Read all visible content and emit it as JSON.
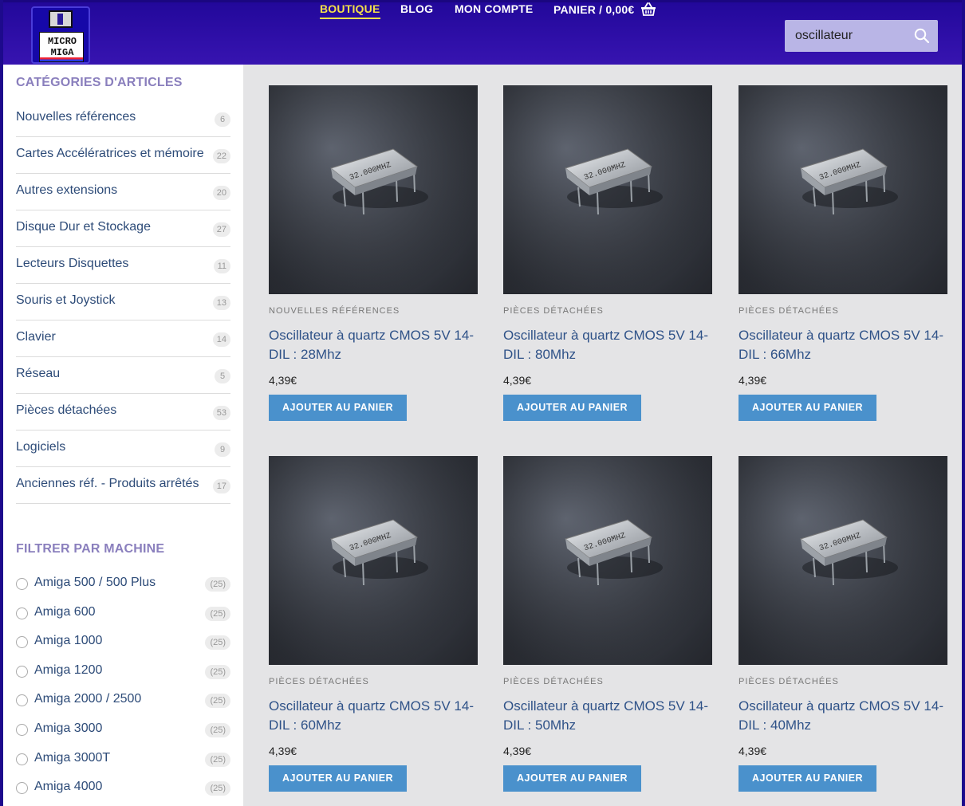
{
  "brand": {
    "logo_text": "MICRO MIGA"
  },
  "nav": {
    "items": [
      {
        "label": "BOUTIQUE",
        "active": true
      },
      {
        "label": "BLOG",
        "active": false
      },
      {
        "label": "MON COMPTE",
        "active": false
      },
      {
        "label": "PANIER / 0,00€",
        "active": false
      }
    ],
    "cart_icon": "basket-icon"
  },
  "search": {
    "value": "oscillateur",
    "icon": "search-icon"
  },
  "sidebar": {
    "categories_title": "CATÉGORIES D'ARTICLES",
    "categories": [
      {
        "label": "Nouvelles références",
        "count": "6"
      },
      {
        "label": "Cartes Accélératrices et mémoire",
        "count": "22"
      },
      {
        "label": "Autres extensions",
        "count": "20"
      },
      {
        "label": "Disque Dur et Stockage",
        "count": "27"
      },
      {
        "label": "Lecteurs Disquettes",
        "count": "11"
      },
      {
        "label": "Souris et Joystick",
        "count": "13"
      },
      {
        "label": "Clavier",
        "count": "14"
      },
      {
        "label": "Réseau",
        "count": "5"
      },
      {
        "label": "Pièces détachées",
        "count": "53"
      },
      {
        "label": "Logiciels",
        "count": "9"
      },
      {
        "label": "Anciennes réf. - Produits arrêtés",
        "count": "17"
      }
    ],
    "filter_title": "FILTRER PAR MACHINE",
    "filters": [
      {
        "label": "Amiga 500 / 500 Plus",
        "count": "(25)"
      },
      {
        "label": "Amiga 600",
        "count": "(25)"
      },
      {
        "label": "Amiga 1000",
        "count": "(25)"
      },
      {
        "label": "Amiga 1200",
        "count": "(25)"
      },
      {
        "label": "Amiga 2000 / 2500",
        "count": "(25)"
      },
      {
        "label": "Amiga 3000",
        "count": "(25)"
      },
      {
        "label": "Amiga 3000T",
        "count": "(25)"
      },
      {
        "label": "Amiga 4000",
        "count": "(25)"
      }
    ]
  },
  "products": [
    {
      "category": "NOUVELLES RÉFÉRENCES",
      "title": "Oscillateur à quartz CMOS 5V 14-DIL : 28Mhz",
      "price": "4,39€",
      "button": "AJOUTER AU PANIER",
      "chip_text": "32.000MHZ"
    },
    {
      "category": "PIÈCES DÉTACHÉES",
      "title": "Oscillateur à quartz CMOS 5V 14-DIL : 80Mhz",
      "price": "4,39€",
      "button": "AJOUTER AU PANIER",
      "chip_text": "32.000MHZ"
    },
    {
      "category": "PIÈCES DÉTACHÉES",
      "title": "Oscillateur à quartz CMOS 5V 14-DIL : 66Mhz",
      "price": "4,39€",
      "button": "AJOUTER AU PANIER",
      "chip_text": "32.000MHZ"
    },
    {
      "category": "PIÈCES DÉTACHÉES",
      "title": "Oscillateur à quartz CMOS 5V 14-DIL : 60Mhz",
      "price": "4,39€",
      "button": "AJOUTER AU PANIER",
      "chip_text": "32.000MHZ"
    },
    {
      "category": "PIÈCES DÉTACHÉES",
      "title": "Oscillateur à quartz CMOS 5V 14-DIL : 50Mhz",
      "price": "4,39€",
      "button": "AJOUTER AU PANIER",
      "chip_text": "32.000MHZ"
    },
    {
      "category": "PIÈCES DÉTACHÉES",
      "title": "Oscillateur à quartz CMOS 5V 14-DIL : 40Mhz",
      "price": "4,39€",
      "button": "AJOUTER AU PANIER",
      "chip_text": "32.000MHZ"
    }
  ],
  "colors": {
    "header": "#2f0fa8",
    "accent": "#f4e04a",
    "button": "#4a91cc",
    "link": "#2f5288",
    "widget_title": "#8a7fbd"
  }
}
